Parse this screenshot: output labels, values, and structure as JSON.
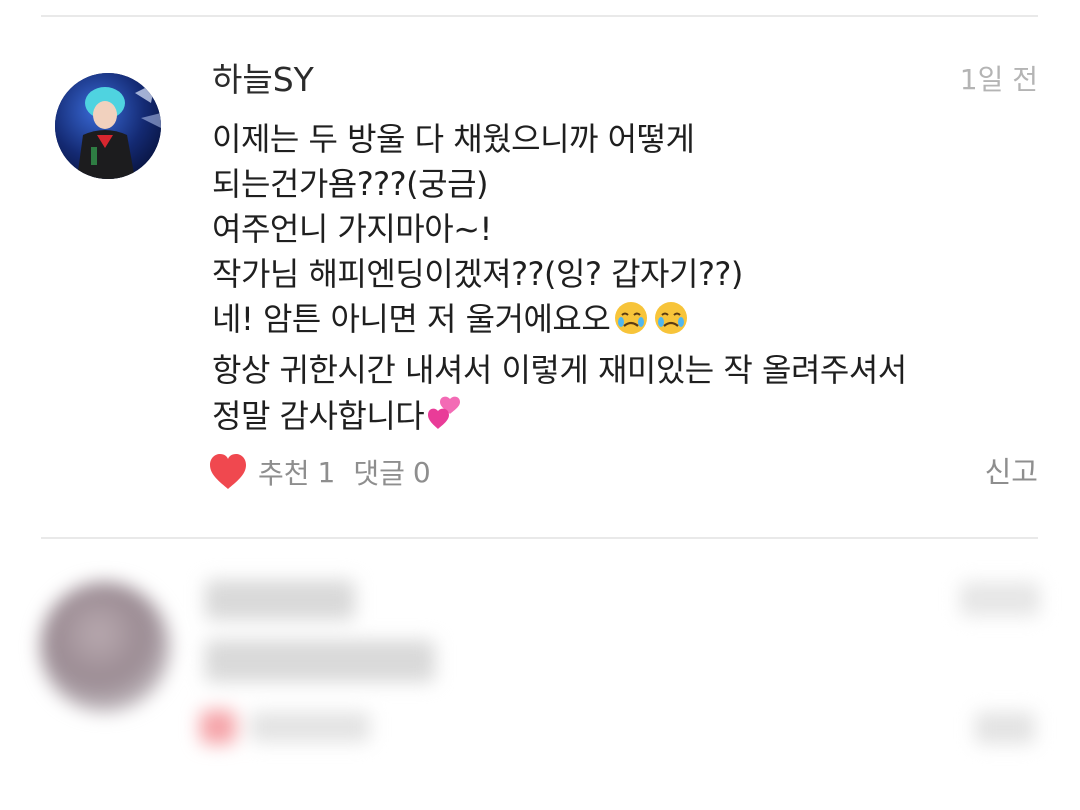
{
  "comment": {
    "author": "하늘SY",
    "time": "1일 전",
    "lines": [
      "이제는 두 방울 다 채웠으니까 어떻게",
      "되는건가욤???(궁금)",
      "여주언니 가지마아~!",
      "작가님 해피엔딩이겠져??(잉? 갑자기??)",
      "네! 암튼 아니면 저 울거에요오",
      "항상 귀한시간 내셔서 이렇게 재미있는 작 올려주셔서",
      "정말 감사합니다"
    ],
    "line5_emojis": [
      "crying-face",
      "crying-face"
    ],
    "line7_emoji": "two-hearts",
    "likes_label": "추천",
    "likes_count": "1",
    "replies_label": "댓글",
    "replies_count": "0",
    "report_label": "신고"
  },
  "colors": {
    "heart": "#f0484f",
    "meta_gray": "#8e8e8e",
    "time_gray": "#b4b4b4",
    "divider": "#e9e9e9"
  }
}
